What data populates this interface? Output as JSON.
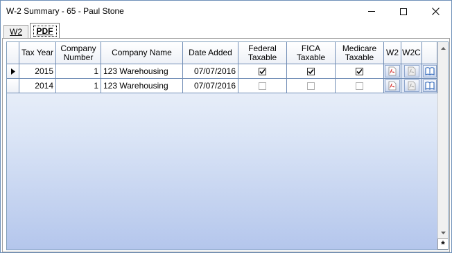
{
  "window": {
    "title": "W-2 Summary - 65 - Paul Stone"
  },
  "tabs": [
    {
      "label": "W2",
      "active": false
    },
    {
      "label": "PDF",
      "active": true
    }
  ],
  "grid": {
    "columns": [
      "Tax Year",
      "Company Number",
      "Company Name",
      "Date Added",
      "Federal Taxable",
      "FICA Taxable",
      "Medicare Taxable",
      "W2",
      "W2C",
      ""
    ],
    "column_lines": {
      "company_number": [
        "Company",
        "Number"
      ],
      "federal_taxable": [
        "Federal",
        "Taxable"
      ],
      "fica_taxable": [
        "FICA",
        "Taxable"
      ],
      "medicare_taxable": [
        "Medicare",
        "Taxable"
      ]
    },
    "rows": [
      {
        "tax_year": "2015",
        "company_number": "1",
        "company_name": "123 Warehousing",
        "date_added": "07/07/2016",
        "federal_taxable": true,
        "fica_taxable": true,
        "medicare_taxable": true,
        "current": true
      },
      {
        "tax_year": "2014",
        "company_number": "1",
        "company_name": "123 Warehousing",
        "date_added": "07/07/2016",
        "federal_taxable": false,
        "fica_taxable": false,
        "medicare_taxable": false,
        "current": false
      }
    ],
    "new_row_symbol": "*"
  },
  "icons": {
    "w2_pdf": "pdf-icon",
    "w2c_pdf": "pdf-disabled-icon",
    "view": "book-icon"
  },
  "colors": {
    "grid_border": "#6f8cb5",
    "grid_background_top": "#f4f7fc",
    "grid_background_bottom": "#b4c6ec",
    "pdf_red": "#d32f2f"
  }
}
